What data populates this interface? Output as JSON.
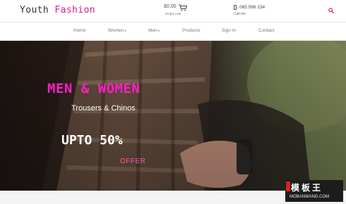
{
  "brand": {
    "part1": "Youth ",
    "part2": "Fashion"
  },
  "cart": {
    "price": "$0.00",
    "label": "Empty Cart"
  },
  "contact": {
    "phone": "085 596 234",
    "label": "Call me"
  },
  "nav": {
    "items": [
      {
        "label": "Home"
      },
      {
        "label": "Women"
      },
      {
        "label": "Men"
      },
      {
        "label": "Products"
      },
      {
        "label": "Sign In"
      },
      {
        "label": "Contact"
      }
    ]
  },
  "hero": {
    "title": "MEN & WOMEN",
    "subtitle": "Trousers & Chinos",
    "offer": "UPTO 50%",
    "cta": "OFFER"
  },
  "watermark": {
    "cn": "模板王",
    "en": "MOBANWANG.COM"
  },
  "colors": {
    "accent": "#d81b84",
    "hero_title": "#ff1ec8",
    "cta": "#ff5aa8"
  },
  "icons": {
    "cart": "cart-icon",
    "phone": "phone-icon",
    "search": "search-icon"
  }
}
